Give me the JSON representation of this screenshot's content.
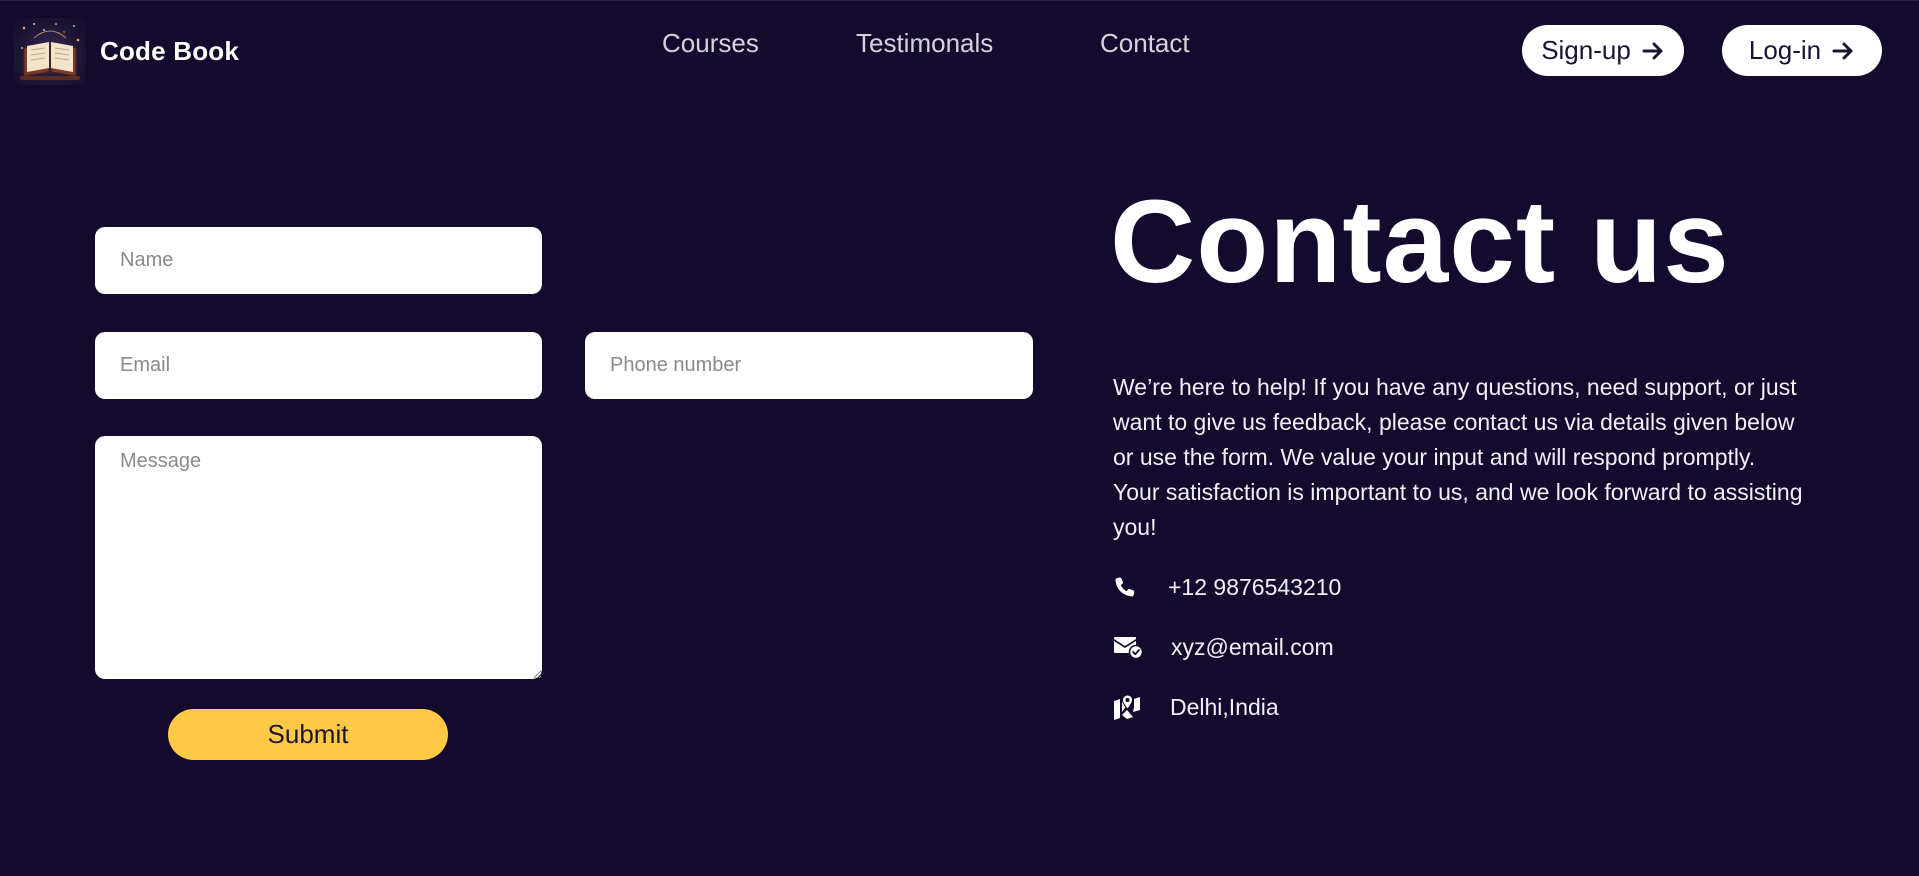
{
  "brand": {
    "name": "Code Book",
    "logo_icon": "book-logo-icon"
  },
  "nav": {
    "links": [
      "Courses",
      "Testimonals",
      "Contact"
    ]
  },
  "auth": {
    "signup_label": "Sign-up",
    "login_label": "Log-in",
    "arrow_icon": "arrow-right-icon"
  },
  "form": {
    "name_placeholder": "Name",
    "email_placeholder": "Email",
    "phone_placeholder": "Phone number",
    "message_placeholder": "Message",
    "submit_label": "Submit"
  },
  "contact": {
    "title": "Contact us",
    "description": "We’re here to help! If you have any questions, need support, or just want to give us feedback, please contact us via details given below or use the form. We value your input and will respond promptly. Your satisfaction is important to us, and we look forward to assisting you!",
    "phone": "+12 9876543210",
    "email": "xyz@email.com",
    "location": "Delhi,India",
    "icons": [
      "phone-icon",
      "mail-check-icon",
      "map-pin-icon"
    ]
  },
  "colors": {
    "background": "#130a2d",
    "accent": "#ffc947",
    "text": "#ffffff",
    "nav_text": "#d6d3df"
  }
}
